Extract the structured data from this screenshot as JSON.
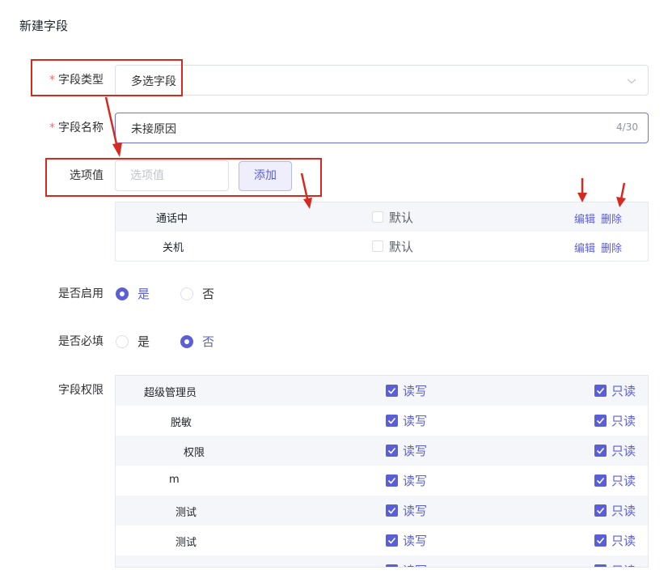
{
  "page": {
    "title": "新建字段"
  },
  "field_type": {
    "label": "字段类型",
    "required_mark": "*",
    "value": "多选字段"
  },
  "field_name": {
    "label": "字段名称",
    "required_mark": "*",
    "value": "未接原因",
    "counter": "4/30"
  },
  "option_value": {
    "label": "选项值",
    "placeholder": "选项值",
    "add_button": "添加"
  },
  "options": [
    {
      "name": "通话中",
      "default_label": "默认",
      "edit_label": "编辑",
      "delete_label": "删除"
    },
    {
      "name": "关机",
      "default_label": "默认",
      "edit_label": "编辑",
      "delete_label": "删除"
    }
  ],
  "enabled": {
    "label": "是否启用",
    "yes": "是",
    "no": "否",
    "selected": "是"
  },
  "required": {
    "label": "是否必填",
    "yes": "是",
    "no": "否",
    "selected": "否"
  },
  "permissions": {
    "label": "字段权限",
    "rows": [
      {
        "role": "超级管理员",
        "rw": "读写",
        "ro": "只读"
      },
      {
        "role": "脱敏",
        "rw": "读写",
        "ro": "只读"
      },
      {
        "role": "权限",
        "rw": "读写",
        "ro": "只读"
      },
      {
        "role": "m",
        "rw": "读写",
        "ro": "只读"
      },
      {
        "role": "测试",
        "rw": "读写",
        "ro": "只读"
      },
      {
        "role": "测试",
        "rw": "读写",
        "ro": "只读"
      },
      {
        "role": "测试",
        "rw": "读写",
        "ro": "只读"
      }
    ]
  },
  "colors": {
    "accent": "#5b5fd6",
    "annotation": "#d42a20",
    "required": "#f56c6c"
  }
}
